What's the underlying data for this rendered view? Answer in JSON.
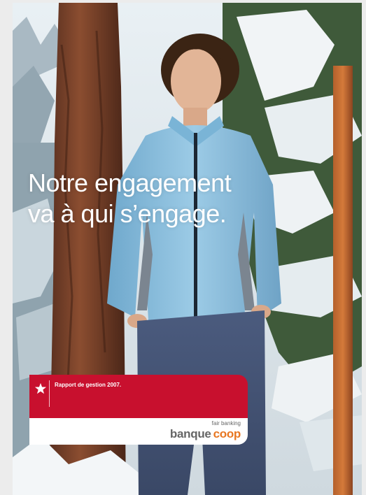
{
  "headline": {
    "line1": "Notre engagement",
    "line2": "va à qui s’engage."
  },
  "report_card": {
    "title": "Rapport de gestion 2007.",
    "star_icon": "star-logo-icon"
  },
  "brand": {
    "tagline": "fair banking",
    "name_part1": "banque",
    "name_part2": "coop"
  },
  "colors": {
    "brand_red": "#c8102e",
    "brand_orange": "#e87722",
    "brand_grey": "#666666",
    "fleece_blue": "#8ec1de"
  }
}
